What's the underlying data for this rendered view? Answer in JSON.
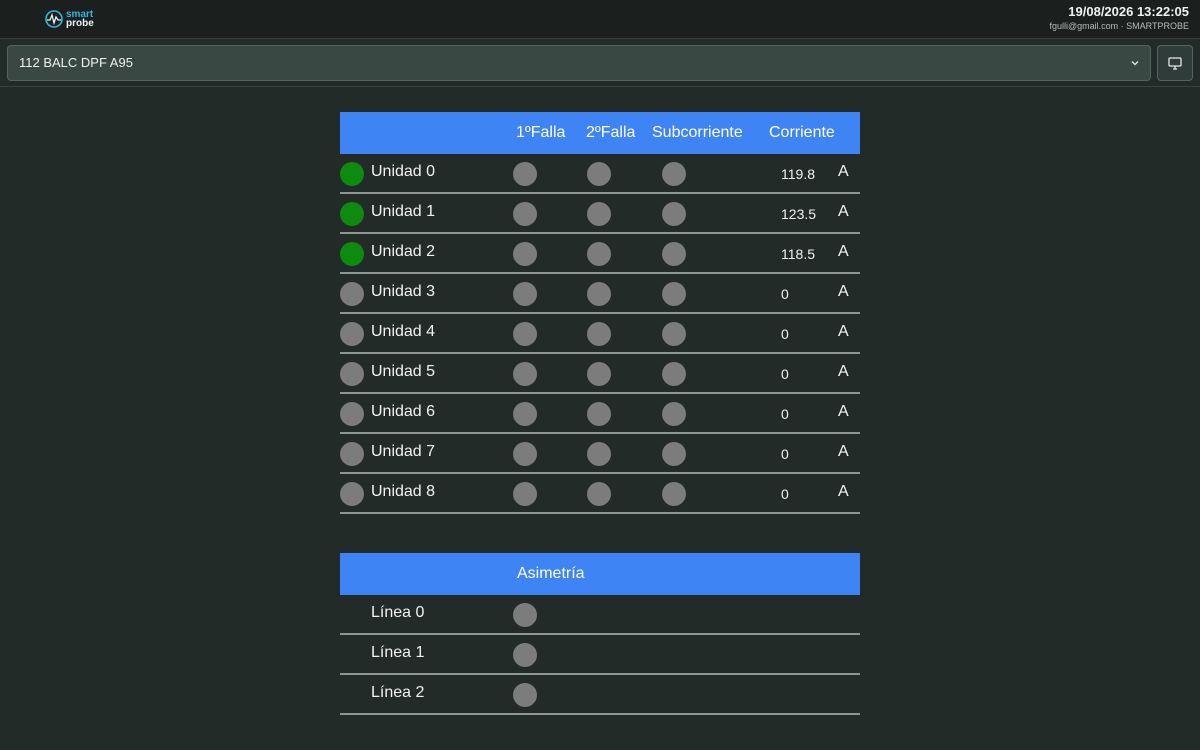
{
  "header": {
    "logo_text_1": "smart",
    "logo_text_2": "probe",
    "datetime": "19/08/2026 13:22:05",
    "user_line": "fgulli@gmail.com · SMARTPROBE"
  },
  "device_select": {
    "selected": "112 BALC DPF A95"
  },
  "units_table": {
    "headers": {
      "falla1": "1ºFalla",
      "falla2": "2ºFalla",
      "subcorriente": "Subcorriente",
      "corriente": "Corriente"
    },
    "rows": [
      {
        "label": "Unidad 0",
        "status": "green",
        "value": "119.8",
        "unit": "A"
      },
      {
        "label": "Unidad 1",
        "status": "green",
        "value": "123.5",
        "unit": "A"
      },
      {
        "label": "Unidad 2",
        "status": "green",
        "value": "118.5",
        "unit": "A"
      },
      {
        "label": "Unidad 3",
        "status": "gray",
        "value": "0",
        "unit": "A"
      },
      {
        "label": "Unidad 4",
        "status": "gray",
        "value": "0",
        "unit": "A"
      },
      {
        "label": "Unidad 5",
        "status": "gray",
        "value": "0",
        "unit": "A"
      },
      {
        "label": "Unidad 6",
        "status": "gray",
        "value": "0",
        "unit": "A"
      },
      {
        "label": "Unidad 7",
        "status": "gray",
        "value": "0",
        "unit": "A"
      },
      {
        "label": "Unidad 8",
        "status": "gray",
        "value": "0",
        "unit": "A"
      }
    ]
  },
  "asym_table": {
    "header": "Asimetría",
    "rows": [
      {
        "label": "Línea 0"
      },
      {
        "label": "Línea 1"
      },
      {
        "label": "Línea 2"
      }
    ]
  },
  "colors": {
    "accent": "#3f84f4",
    "status_on": "#0e8a0e",
    "status_off": "#7c7c7c"
  }
}
